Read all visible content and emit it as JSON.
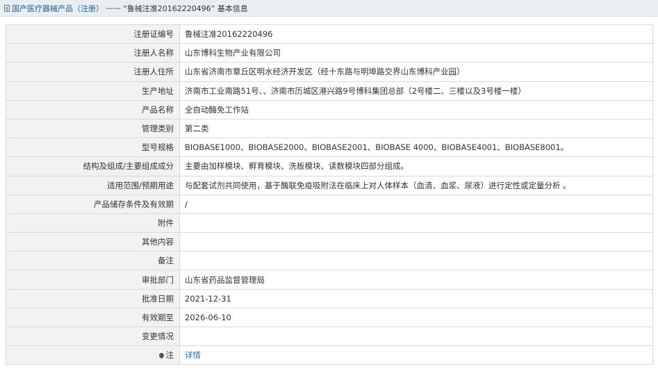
{
  "breadcrumb": {
    "root": "国产医疗器械产品（注册）",
    "separator": "——",
    "current": "“鲁械注准20162220496” 基本信息"
  },
  "rows": [
    {
      "label": "注册证编号",
      "value": "鲁械注准20162220496"
    },
    {
      "label": "注册人名称",
      "value": "山东博科生物产业有限公司"
    },
    {
      "label": "注册人住所",
      "value": "山东省济南市章丘区明水经济开发区（经十东路与明埠路交界山东博科产业园）"
    },
    {
      "label": "生产地址",
      "value": "济南市工业南路51号、、济南市历城区港兴路9号博科集团总部（2号楼二、三楼以及3号楼一楼）"
    },
    {
      "label": "产品名称",
      "value": "全自动酶免工作站"
    },
    {
      "label": "管理类别",
      "value": "第二类"
    },
    {
      "label": "型号规格",
      "value": "BIOBASE1000、BIOBASE2000、BIOBASE2001、BIOBASE 4000、BIOBASE4001、BIOBASE8001。"
    },
    {
      "label": "结构及组成/主要组成成分",
      "value": "主要由加样模块、孵育模块、洗板模块、读数模块四部分组成。"
    },
    {
      "label": "适用范围/预期用途",
      "value": "与配套试剂共同使用，基于酶联免疫吸附法在临床上对人体样本（血清、血浆、尿液）进行定性或定量分析 。"
    },
    {
      "label": "产品储存条件及有效期",
      "value": "/"
    },
    {
      "label": "附件",
      "value": ""
    },
    {
      "label": "其他内容",
      "value": ""
    },
    {
      "label": "备注",
      "value": ""
    },
    {
      "label": "审批部门",
      "value": "山东省药品监督管理局"
    },
    {
      "label": "批准日期",
      "value": "2021-12-31"
    },
    {
      "label": "有效期至",
      "value": "2026-06-10"
    },
    {
      "label": "变更情况",
      "value": ""
    }
  ],
  "note_row": {
    "icon": "pin-icon",
    "label": "注",
    "link_text": "详情"
  }
}
